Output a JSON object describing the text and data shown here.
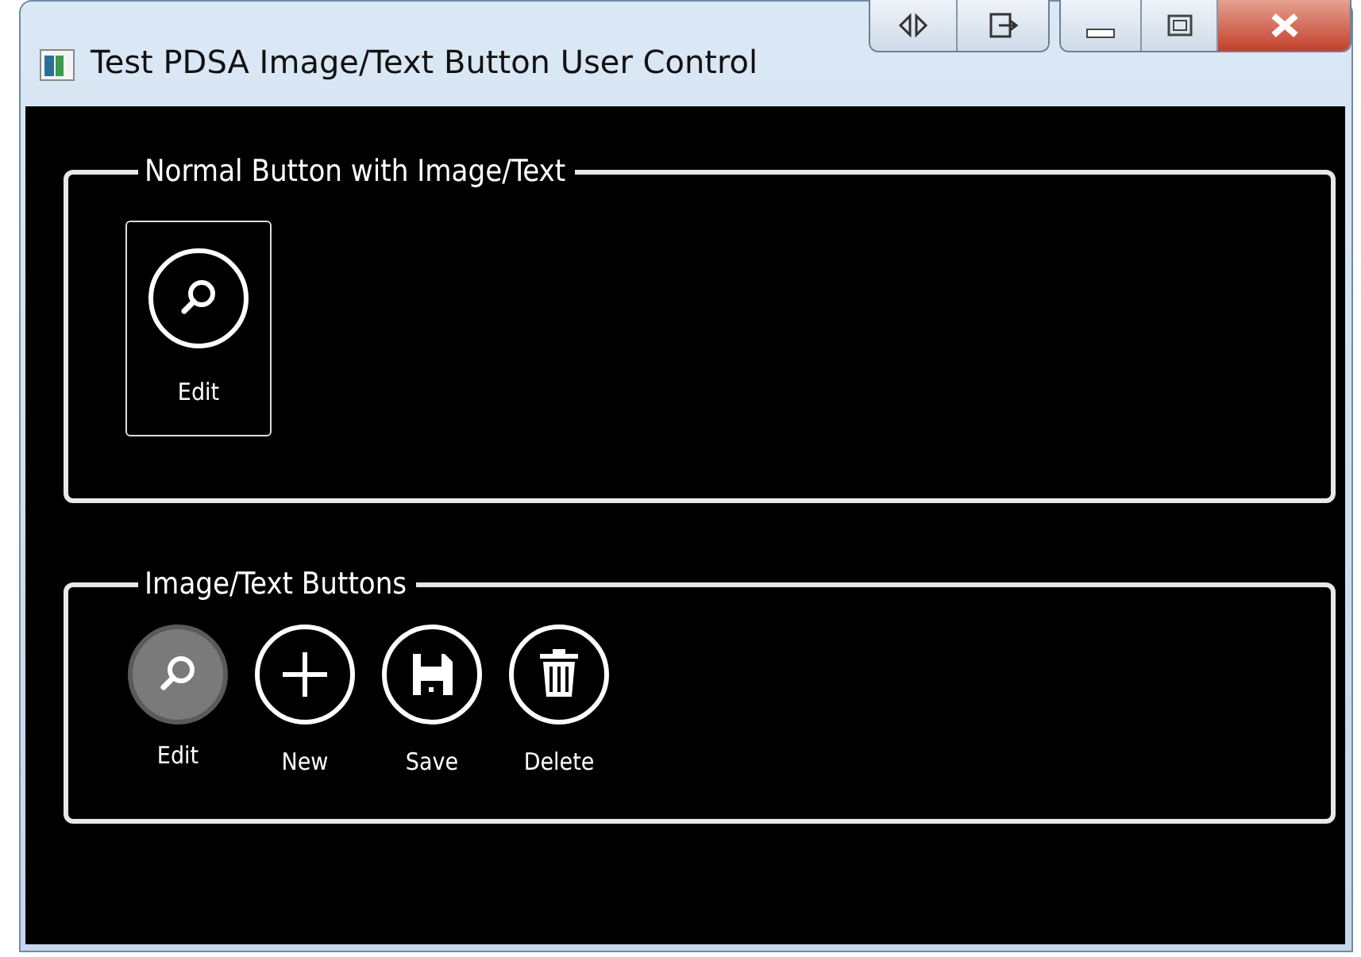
{
  "window": {
    "title": "Test PDSA Image/Text Button User Control"
  },
  "groups": [
    {
      "title": "Normal Button with Image/Text",
      "kind": "framed",
      "buttons": [
        {
          "label": "Edit",
          "kind": "search",
          "highlighted": false
        }
      ]
    },
    {
      "title": "Image/Text Buttons",
      "kind": "plain",
      "buttons": [
        {
          "label": "Edit",
          "kind": "search",
          "highlighted": true
        },
        {
          "label": "New",
          "kind": "plus",
          "highlighted": false
        },
        {
          "label": "Save",
          "kind": "save",
          "highlighted": false
        },
        {
          "label": "Delete",
          "kind": "trash",
          "highlighted": false
        }
      ]
    }
  ]
}
